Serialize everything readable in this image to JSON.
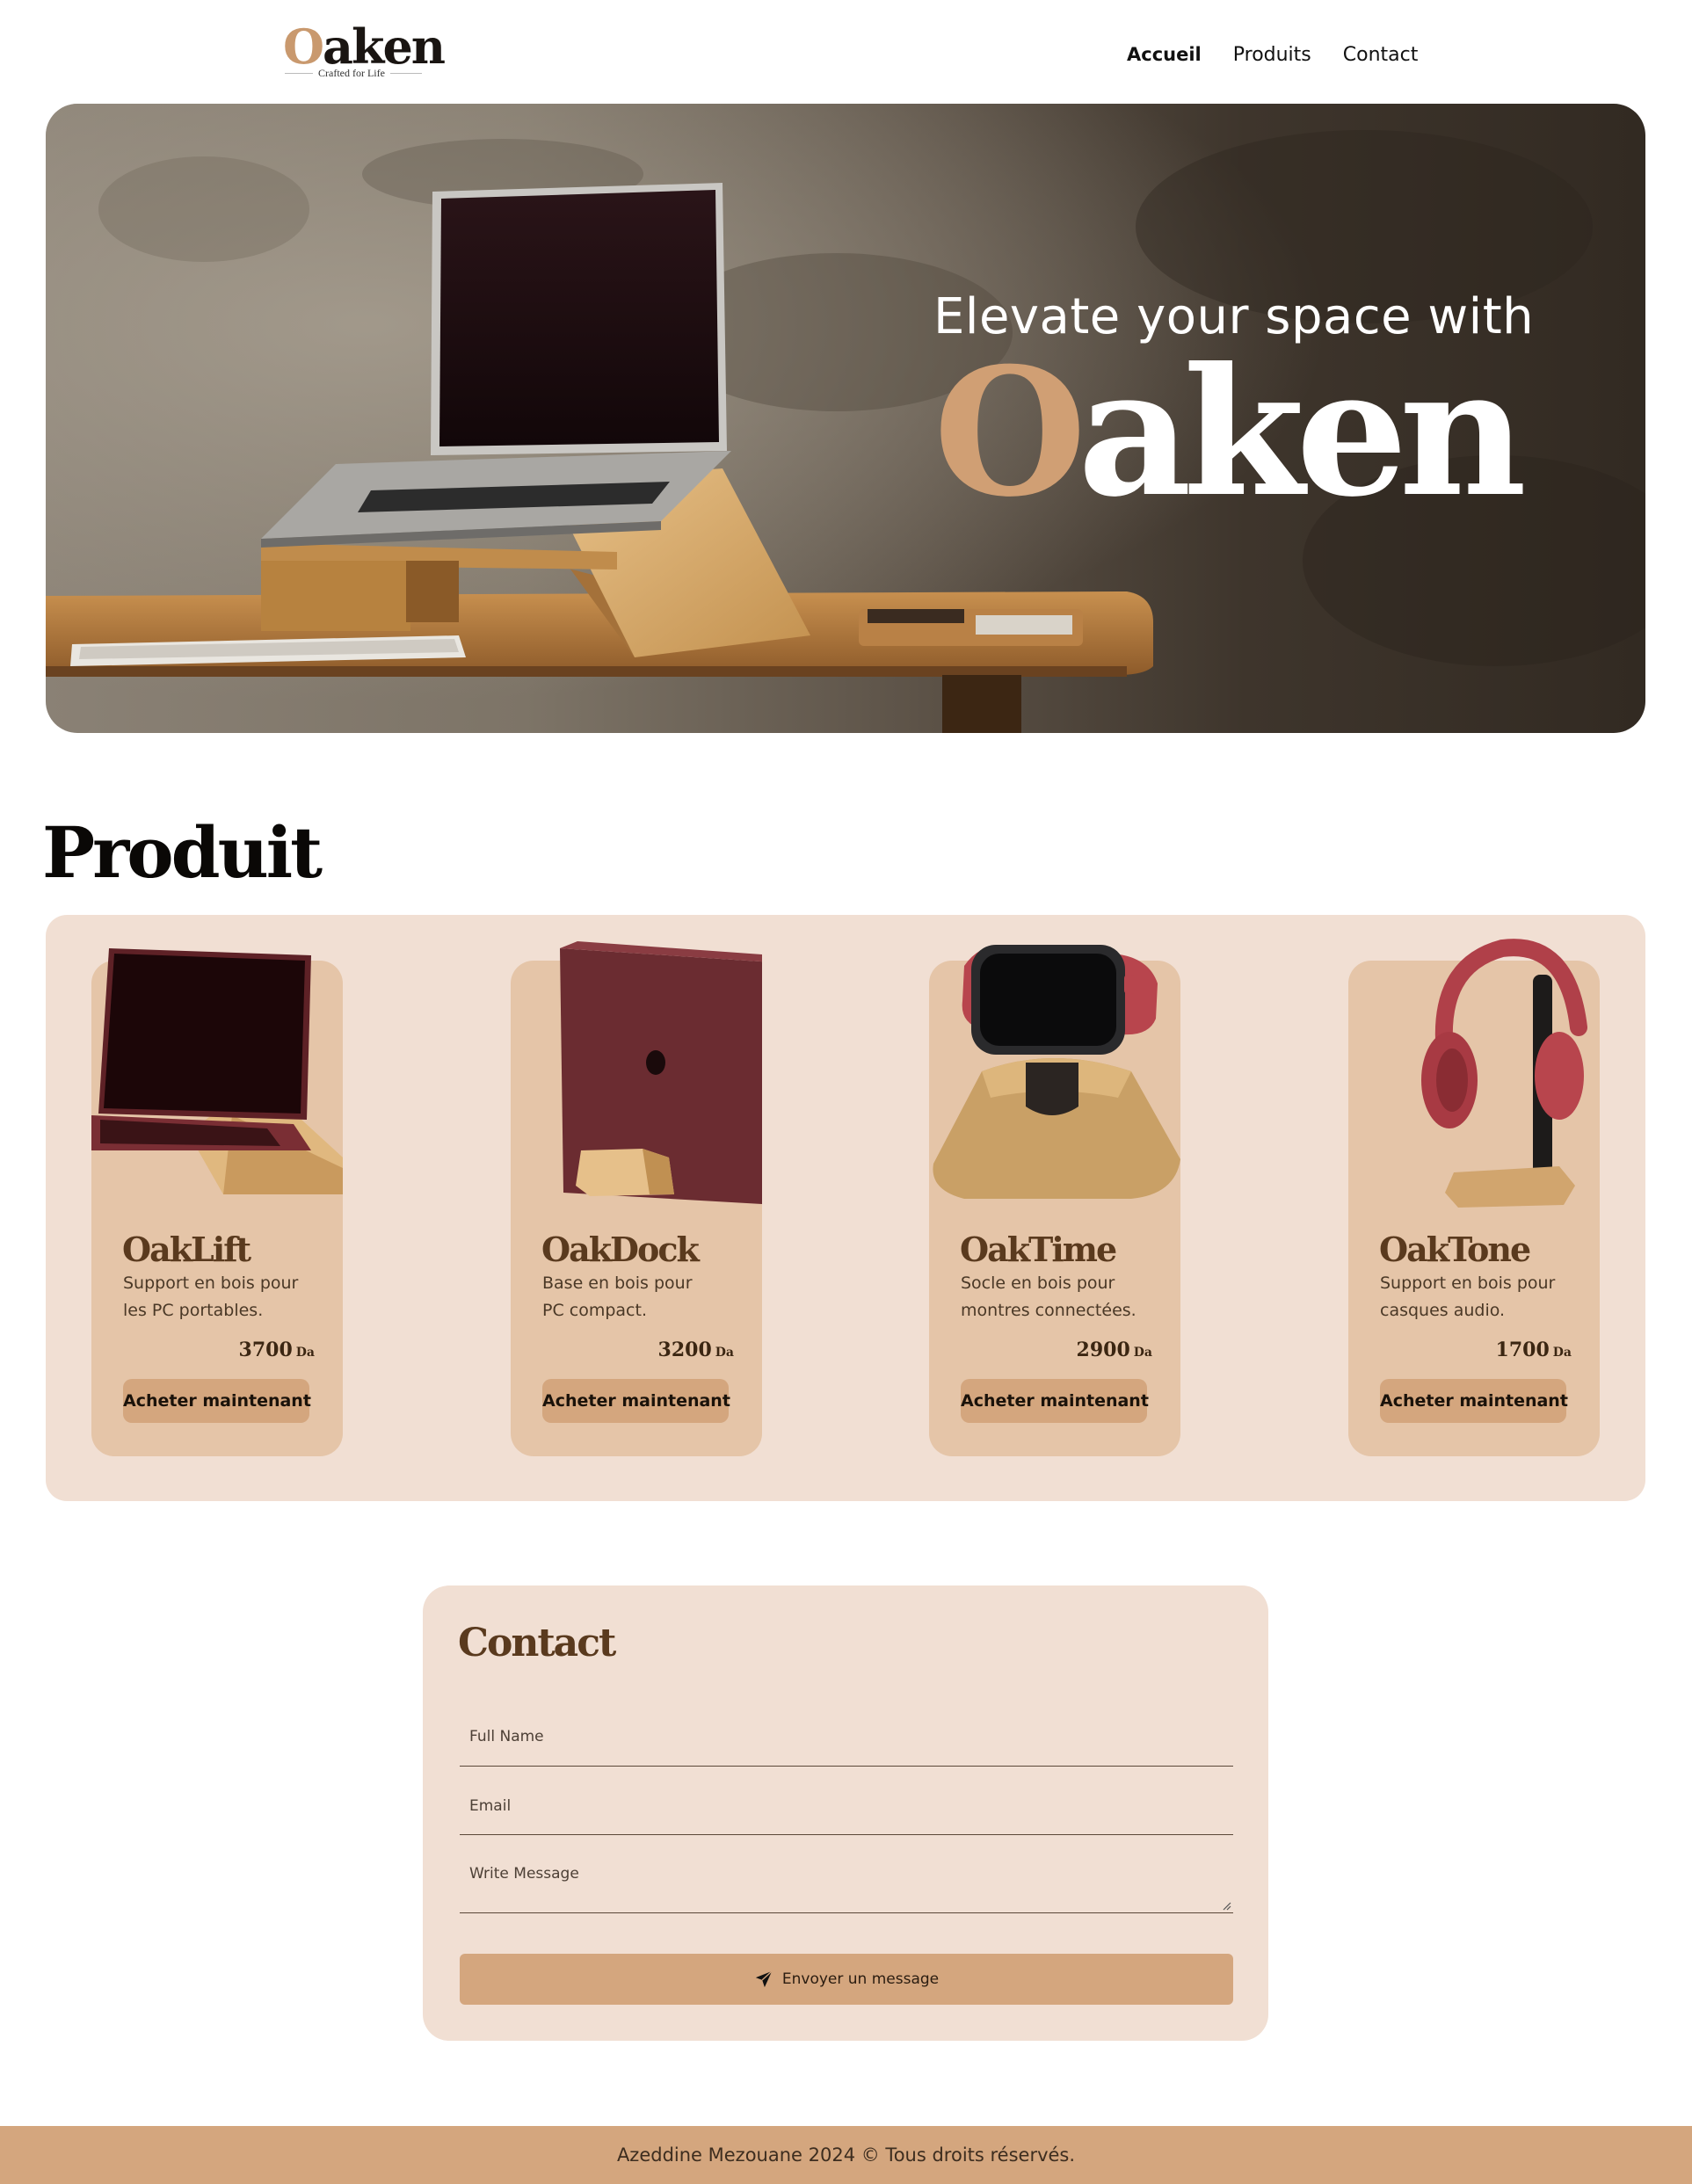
{
  "brand": {
    "logo_first": "O",
    "logo_rest": "aken",
    "tagline": "Crafted for Life"
  },
  "nav": {
    "items": [
      {
        "label": "Accueil",
        "active": true
      },
      {
        "label": "Produits",
        "active": false
      },
      {
        "label": "Contact",
        "active": false
      }
    ]
  },
  "hero": {
    "line1": "Elevate your space with",
    "brand_first": "O",
    "brand_rest": "aken"
  },
  "products": {
    "title": "Produit",
    "items": [
      {
        "name": "OakLift",
        "desc": "Support en bois pour les PC portables.",
        "price": "3700",
        "currency": "Da",
        "button": "Acheter maintenant",
        "image": "laptop-stand-image"
      },
      {
        "name": "OakDock",
        "desc": "Base en bois pour PC compact.",
        "price": "3200",
        "currency": "Da",
        "button": "Acheter maintenant",
        "image": "laptop-dock-image"
      },
      {
        "name": "OakTime",
        "desc": "Socle en bois pour montres connectées.",
        "price": "2900",
        "currency": "Da",
        "button": "Acheter maintenant",
        "image": "watch-stand-image"
      },
      {
        "name": "OakTone",
        "desc": "Support en bois pour casques audio.",
        "price": "1700",
        "currency": "Da",
        "button": "Acheter maintenant",
        "image": "headphone-stand-image"
      }
    ]
  },
  "contact": {
    "title": "Contact",
    "fullname_placeholder": "Full Name",
    "email_placeholder": "Email",
    "message_placeholder": "Write Message",
    "send_label": "Envoyer un message",
    "send_icon": "paper-plane-icon"
  },
  "footer": {
    "text": "Azeddine Mezouane 2024 © Tous droits réservés."
  },
  "colors": {
    "accent": "#d4a67e",
    "panel": "#f1dfd3",
    "card": "#e5c5a8",
    "heading_brown": "#5a3a1e"
  }
}
